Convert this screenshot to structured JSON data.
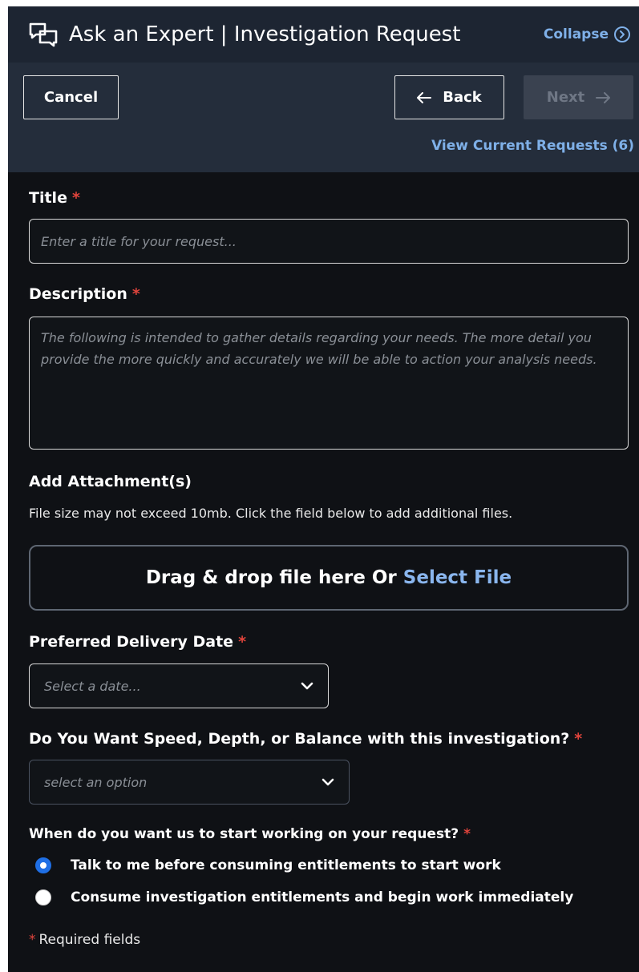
{
  "header": {
    "title": "Ask an Expert | Investigation Request",
    "collapse_label": "Collapse"
  },
  "toolbar": {
    "cancel_label": "Cancel",
    "back_label": "Back",
    "next_label": "Next",
    "view_requests_label": "View Current Requests (6)"
  },
  "form": {
    "required_marker": "*",
    "title": {
      "label": "Title",
      "placeholder": "Enter a title for your request..."
    },
    "description": {
      "label": "Description",
      "placeholder": "The following is intended to gather details regarding your needs. The more detail you provide the more quickly and accurately we will be able to action your analysis needs."
    },
    "attachments": {
      "label": "Add Attachment(s)",
      "hint": "File size may not exceed 10mb. Click the field below to add additional files.",
      "dropzone_text": "Drag & drop file here Or",
      "select_file_label": "Select File"
    },
    "delivery_date": {
      "label": "Preferred Delivery Date",
      "placeholder": "Select a date..."
    },
    "priority": {
      "label": "Do You Want Speed, Depth, or Balance with this investigation?",
      "placeholder": "select an option"
    },
    "start_work": {
      "label": "When do you want us to start working on your request?",
      "options": [
        {
          "label": "Talk to me before consuming entitlements to start work",
          "checked": true
        },
        {
          "label": "Consume investigation entitlements and begin work immediately",
          "checked": false
        }
      ]
    },
    "required_note": "Required fields"
  },
  "colors": {
    "accent_link": "#7fb0e8",
    "required": "#e0443c",
    "radio_selected": "#1f6fe5",
    "background": "#0f1115"
  },
  "icons": [
    "chat-bubbles-icon",
    "chevron-circle-right-icon",
    "arrow-left-icon",
    "arrow-right-icon",
    "chevron-down-icon"
  ]
}
